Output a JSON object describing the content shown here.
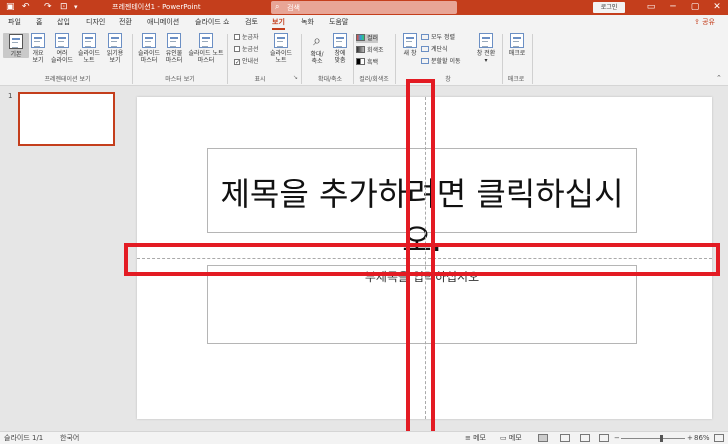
{
  "titlebar": {
    "app_title": "프레젠테이션1 - PowerPoint",
    "search_placeholder": "검색",
    "login": "로그인",
    "minimize": "─",
    "restore": "▢",
    "close": "✕"
  },
  "tabs": [
    {
      "label": "파일"
    },
    {
      "label": "홈"
    },
    {
      "label": "삽입"
    },
    {
      "label": "디자인"
    },
    {
      "label": "전환"
    },
    {
      "label": "애니메이션"
    },
    {
      "label": "슬라이드 쇼"
    },
    {
      "label": "검토"
    },
    {
      "label": "보기"
    },
    {
      "label": "녹화"
    },
    {
      "label": "도움말"
    }
  ],
  "share": "공유",
  "ribbon": {
    "presentation_views": {
      "group": "프레젠테이션 보기",
      "buttons": [
        {
          "l1": "기본",
          "l2": ""
        },
        {
          "l1": "개요",
          "l2": "보기"
        },
        {
          "l1": "여러",
          "l2": "슬라이드"
        },
        {
          "l1": "슬라이드",
          "l2": "노트"
        },
        {
          "l1": "읽기용",
          "l2": "보기"
        }
      ]
    },
    "master_views": {
      "group": "마스터 보기",
      "buttons": [
        {
          "l1": "슬라이드",
          "l2": "마스터"
        },
        {
          "l1": "유인물",
          "l2": "마스터"
        },
        {
          "l1": "슬라이드 노트",
          "l2": "마스터"
        }
      ]
    },
    "show": {
      "group": "표시",
      "ruler": "눈금자",
      "gridlines": "눈금선",
      "guides": "안내선",
      "notes_l1": "슬라이드",
      "notes_l2": "노트"
    },
    "zoom": {
      "group": "확대/축소",
      "zoom_l1": "확대/",
      "zoom_l2": "축소",
      "fit_l1": "창에",
      "fit_l2": "맞춤"
    },
    "color": {
      "group": "컬러/회색조",
      "color": "컬러",
      "grayscale": "회색조",
      "bw": "흑백"
    },
    "window": {
      "group": "창",
      "new_window_l1": "새 창",
      "arrange_all": "모두 정렬",
      "cascade": "계단식",
      "move_split": "분할할 이동",
      "switch_l1": "창 전환"
    },
    "macro": {
      "group": "매크로",
      "label": "매크로"
    }
  },
  "thumbnail": {
    "number": "1"
  },
  "slide": {
    "title_placeholder": "제목을 추가하려면 클릭하십시오.",
    "subtitle_placeholder": "부제목을 입력하십시오"
  },
  "statusbar": {
    "slide_count": "슬라이드 1/1",
    "language": "한국어",
    "notes": "메모",
    "comments": "메모",
    "zoom": "86%"
  },
  "colors": {
    "accent": "#c43e1c",
    "highlight": "#e31b23"
  }
}
